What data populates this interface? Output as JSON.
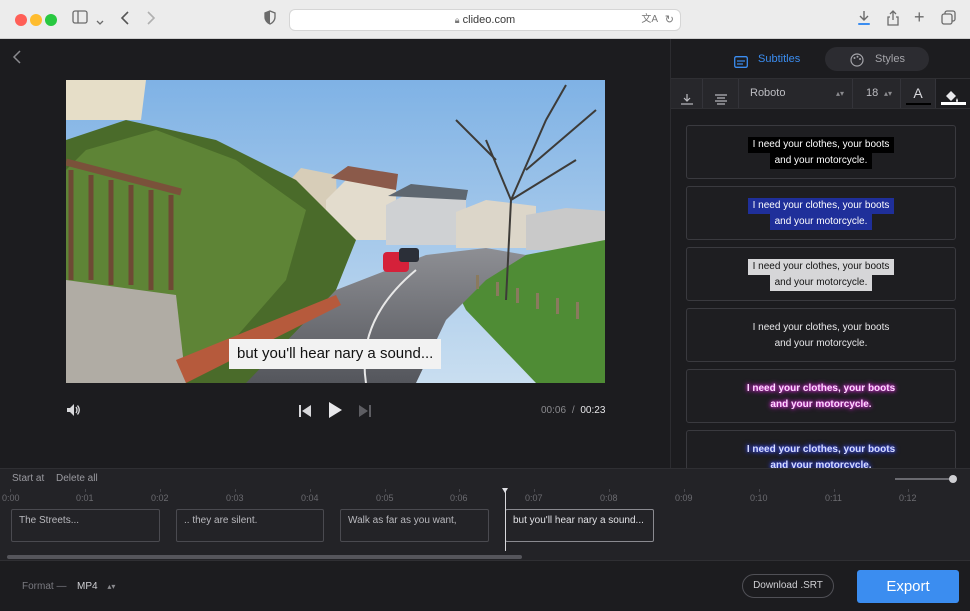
{
  "browser": {
    "url": "clideo.com",
    "colors": {
      "close": "#ff5f57",
      "minimize": "#febc2e",
      "maximize": "#28c840"
    }
  },
  "player": {
    "caption": "but you'll hear nary a sound...",
    "time_current": "00:06",
    "time_separator": "/",
    "time_total": "00:23"
  },
  "panel": {
    "tabs": [
      {
        "label": "Subtitles"
      },
      {
        "label": "Styles"
      }
    ],
    "font_name": "Roboto",
    "font_size": "18",
    "styles": [
      {
        "line1": "I need your clothes, your boots",
        "line2": "and your motorcycle.",
        "color": "#ffffff",
        "bg": "#000000"
      },
      {
        "line1": "I need your clothes, your boots",
        "line2": "and your motorcycle.",
        "color": "#ffffff",
        "bg": "#1f2f9a"
      },
      {
        "line1": "I need your clothes, your boots",
        "line2": "and your motorcycle.",
        "color": "#111111",
        "bg": "#d6d6d8"
      },
      {
        "line1": "I need your clothes, your boots",
        "line2": "and your motorcycle.",
        "color": "#e8e8ea",
        "bg": "transparent"
      },
      {
        "line1": "I need your clothes, your boots",
        "line2": "and your motorcycle.",
        "color": "#ffd6ff",
        "bg": "transparent"
      },
      {
        "line1": "I need your clothes, your boots",
        "line2": "and your motorcycle.",
        "color": "#d6dcff",
        "bg": "transparent"
      }
    ]
  },
  "timeline": {
    "start_at": "Start at",
    "delete_all": "Delete all",
    "ticks": [
      "0:00",
      "0:01",
      "0:02",
      "0:03",
      "0:04",
      "0:05",
      "0:06",
      "0:07",
      "0:08",
      "0:09",
      "0:10",
      "0:11",
      "0:12"
    ],
    "clips": [
      {
        "text": "The Streets..."
      },
      {
        "text": ".. they are silent."
      },
      {
        "text": "Walk as far as you want,"
      },
      {
        "text": "but you'll hear nary a sound..."
      }
    ]
  },
  "footer": {
    "format_label": "Format —",
    "format_value": "MP4",
    "download_srt": "Download .SRT",
    "export": "Export"
  },
  "accent": "#3b8df0"
}
